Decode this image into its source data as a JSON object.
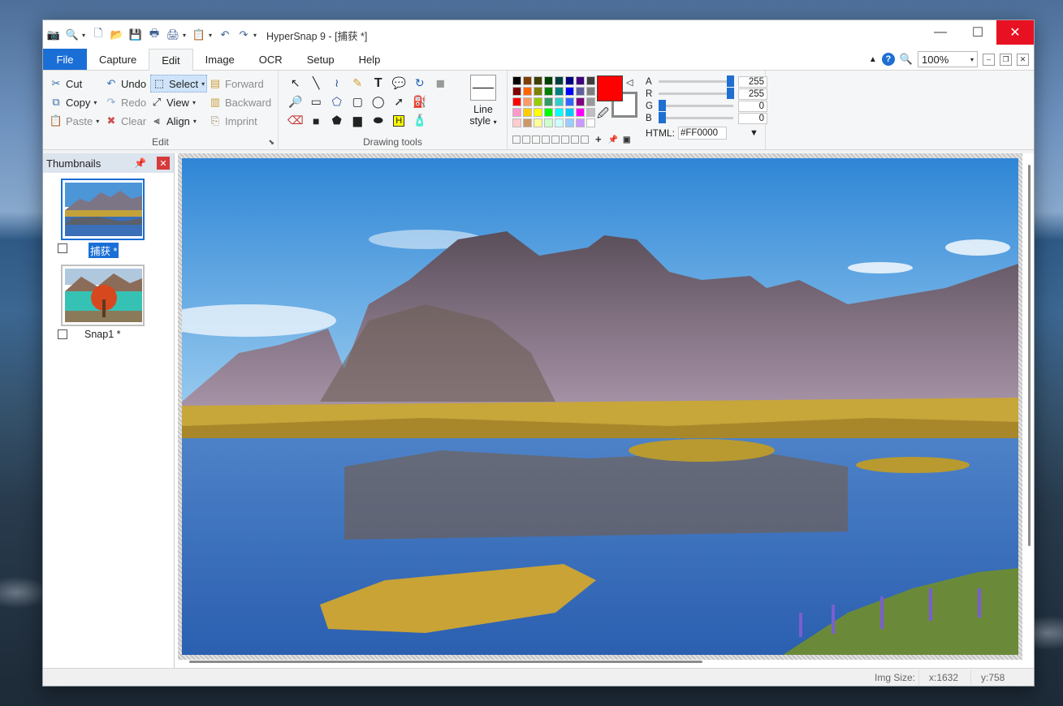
{
  "window": {
    "title": "HyperSnap 9 - [捕获 *]",
    "controls": {
      "minimize": "—",
      "maximize": "☐",
      "close": "✕"
    }
  },
  "quick_access": [
    "camera-icon",
    "zoom-icon",
    "new-icon",
    "open-icon",
    "save-icon",
    "print-icon",
    "scan-icon",
    "clipboard-icon",
    "undo-icon",
    "redo-icon"
  ],
  "menu": {
    "tabs": [
      "File",
      "Capture",
      "Edit",
      "Image",
      "OCR",
      "Setup",
      "Help"
    ],
    "active_tab": "Edit",
    "zoom_value": "100%"
  },
  "ribbon": {
    "edit_group": {
      "label": "Edit",
      "cut": "Cut",
      "copy": "Copy",
      "paste": "Paste",
      "undo": "Undo",
      "redo": "Redo",
      "clear": "Clear",
      "select": "Select",
      "view": "View",
      "align": "Align",
      "forward": "Forward",
      "backward": "Backward",
      "imprint": "Imprint"
    },
    "drawing_group": {
      "label": "Drawing tools",
      "line_style": "Line",
      "line_style_2": "style"
    },
    "colors": {
      "primary": "#FF0000",
      "secondary": "#FFFFFF",
      "swatches": [
        "#000000",
        "#7f3f00",
        "#3f3f00",
        "#003f00",
        "#003f3f",
        "#00007f",
        "#3f007f",
        "#3f3f3f",
        "#7f0000",
        "#ff6600",
        "#7f7f00",
        "#007f00",
        "#007f7f",
        "#0000ff",
        "#5f5f9f",
        "#808080",
        "#ff0000",
        "#ff9966",
        "#99cc00",
        "#339966",
        "#33cccc",
        "#3366ff",
        "#800080",
        "#999999",
        "#ff99cc",
        "#ffcc00",
        "#ffff00",
        "#00ff00",
        "#00ffff",
        "#00ccff",
        "#ff00ff",
        "#c0c0c0",
        "#ffcccc",
        "#cc9966",
        "#ffff99",
        "#ccffcc",
        "#ccffff",
        "#99ccff",
        "#cc99ff",
        "#ffffff"
      ],
      "alpha_label": "A",
      "alpha": "255",
      "red_label": "R",
      "red": "255",
      "green_label": "G",
      "green": "0",
      "blue_label": "B",
      "blue": "0",
      "html_label": "HTML:",
      "html_value": "#FF0000"
    }
  },
  "thumbnails": {
    "title": "Thumbnails",
    "items": [
      {
        "label": "捕获 *",
        "selected": true
      },
      {
        "label": "Snap1 *",
        "selected": false
      }
    ]
  },
  "status": {
    "img_size_label": "Img Size:",
    "x": "x:1632",
    "y": "y:758"
  }
}
